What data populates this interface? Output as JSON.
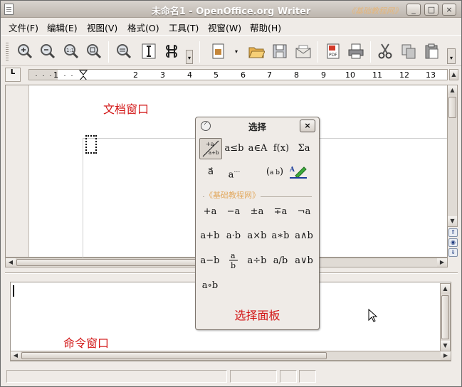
{
  "window": {
    "title": "未命名1 - OpenOffice.org Writer",
    "watermark": "《基础教程网》",
    "controls": [
      "_",
      "□",
      "×"
    ]
  },
  "menu": [
    "文件(F)",
    "编辑(E)",
    "视图(V)",
    "格式(O)",
    "工具(T)",
    "视窗(W)",
    "帮助(H)"
  ],
  "toolbar": {
    "icons": [
      "zoom-in-icon",
      "zoom-out-icon",
      "zoom-100-icon",
      "zoom-page-icon",
      "zoom-optimal-icon",
      "insert-text-icon",
      "formula-cursor-icon",
      "more-icon",
      "new-document-icon",
      "open-icon",
      "save-icon",
      "email-icon",
      "export-pdf-icon",
      "print-icon",
      "cut-icon",
      "copy-icon",
      "paste-icon",
      "overflow-icon"
    ]
  },
  "ruler": {
    "corner": "L",
    "numbers": [
      "1",
      "2",
      "3",
      "4",
      "5",
      "6",
      "7",
      "8",
      "9",
      "10",
      "11",
      "12",
      "13"
    ]
  },
  "annotations": {
    "document_window": "文档窗口",
    "command_window": "命令窗口",
    "selection_panel": "选择面板"
  },
  "panel": {
    "title": "选择",
    "close": "×",
    "watermark": "《基础教程网》",
    "categories": [
      "+a/a+b",
      "a≤b",
      "a∈A",
      "f(x)",
      "Σa",
      "a⃗",
      "a…",
      "(a b)",
      "format"
    ],
    "operators": [
      "+a",
      "−a",
      "±a",
      "∓a",
      "¬a",
      "a+b",
      "a·b",
      "a×b",
      "a∗b",
      "a∧b",
      "a−b",
      "a/b frac",
      "a÷b",
      "a/b",
      "a∨b",
      "a∘b"
    ]
  }
}
